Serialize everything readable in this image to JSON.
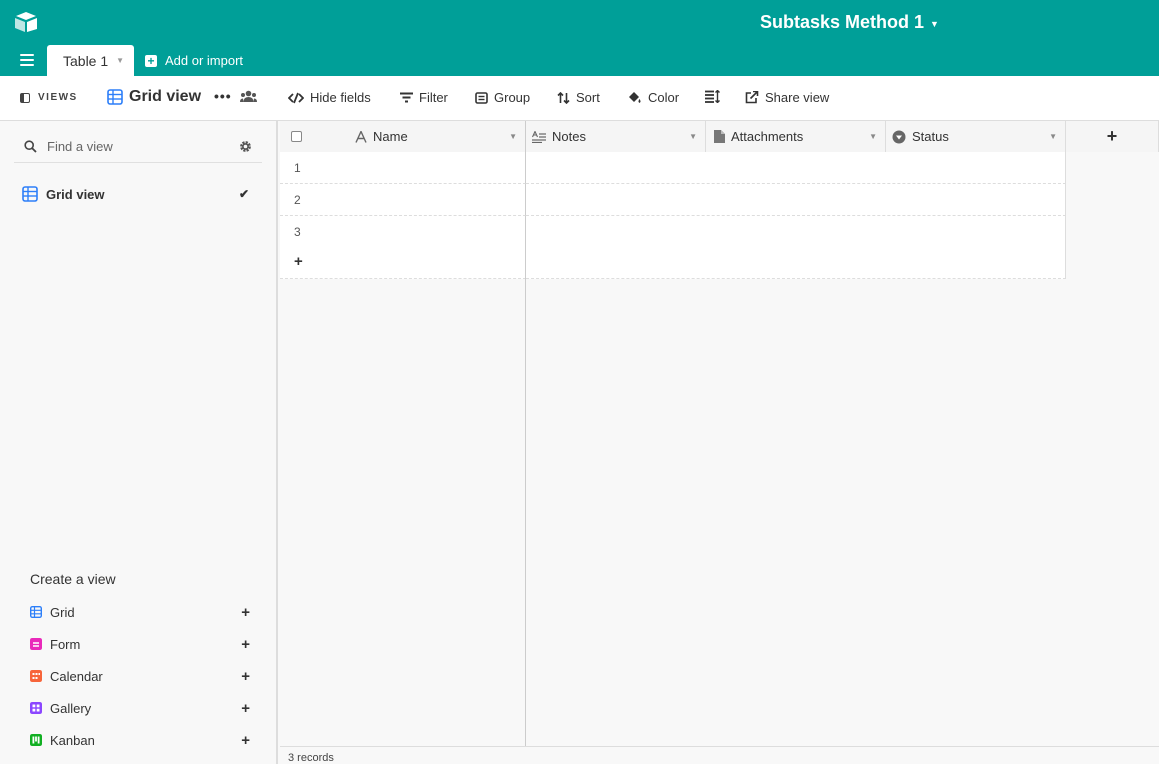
{
  "app": {
    "base_title": "Subtasks Method 1",
    "accent_color": "#009f98",
    "logo_icon": "airtable-logo-icon"
  },
  "tabs": {
    "active_table": "Table 1",
    "add_or_import": "Add or import"
  },
  "toolbar": {
    "views_label": "VIEWS",
    "current_view": "Grid view",
    "more_label": "•••",
    "hide_fields": "Hide fields",
    "filter": "Filter",
    "group": "Group",
    "sort": "Sort",
    "color": "Color",
    "share_view": "Share view"
  },
  "sidebar": {
    "search_placeholder": "Find a view",
    "views": [
      {
        "label": "Grid view",
        "selected": true,
        "check": "✔"
      }
    ],
    "create_title": "Create a view",
    "create_items": [
      {
        "label": "Grid",
        "color": "#2d7ff9",
        "icon": "grid-icon"
      },
      {
        "label": "Form",
        "color": "#e929ba",
        "icon": "form-icon"
      },
      {
        "label": "Calendar",
        "color": "#f7653b",
        "icon": "calendar-icon"
      },
      {
        "label": "Gallery",
        "color": "#8b46ff",
        "icon": "gallery-icon"
      },
      {
        "label": "Kanban",
        "color": "#11af22",
        "icon": "kanban-icon"
      }
    ],
    "add_symbol": "+"
  },
  "grid": {
    "columns": [
      {
        "label": "Name",
        "icon": "text-field-icon"
      },
      {
        "label": "Notes",
        "icon": "long-text-icon"
      },
      {
        "label": "Attachments",
        "icon": "attachment-icon"
      },
      {
        "label": "Status",
        "icon": "single-select-icon"
      }
    ],
    "add_column_symbol": "+",
    "rows": [
      "1",
      "2",
      "3"
    ],
    "add_row_symbol": "+",
    "record_count": "3 records"
  }
}
